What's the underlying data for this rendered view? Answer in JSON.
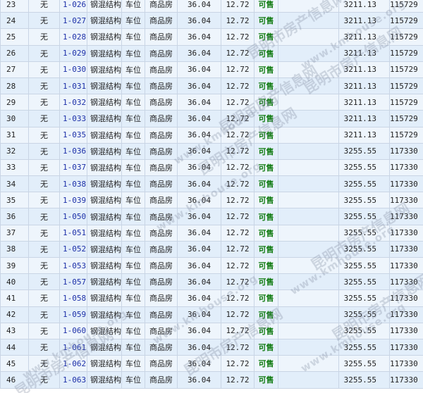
{
  "table": {
    "rows": [
      {
        "no": "23",
        "opt": "无",
        "unit": "1-026",
        "struct": "钢混结构",
        "use": "车位",
        "type": "商品房",
        "area1": "36.04",
        "area2": "12.72",
        "status": "可售",
        "price": "3211.13",
        "total": "115729"
      },
      {
        "no": "24",
        "opt": "无",
        "unit": "1-027",
        "struct": "钢混结构",
        "use": "车位",
        "type": "商品房",
        "area1": "36.04",
        "area2": "12.72",
        "status": "可售",
        "price": "3211.13",
        "total": "115729"
      },
      {
        "no": "25",
        "opt": "无",
        "unit": "1-028",
        "struct": "钢混结构",
        "use": "车位",
        "type": "商品房",
        "area1": "36.04",
        "area2": "12.72",
        "status": "可售",
        "price": "3211.13",
        "total": "115729"
      },
      {
        "no": "26",
        "opt": "无",
        "unit": "1-029",
        "struct": "钢混结构",
        "use": "车位",
        "type": "商品房",
        "area1": "36.04",
        "area2": "12.72",
        "status": "可售",
        "price": "3211.13",
        "total": "115729"
      },
      {
        "no": "27",
        "opt": "无",
        "unit": "1-030",
        "struct": "钢混结构",
        "use": "车位",
        "type": "商品房",
        "area1": "36.04",
        "area2": "12.72",
        "status": "可售",
        "price": "3211.13",
        "total": "115729"
      },
      {
        "no": "28",
        "opt": "无",
        "unit": "1-031",
        "struct": "钢混结构",
        "use": "车位",
        "type": "商品房",
        "area1": "36.04",
        "area2": "12.72",
        "status": "可售",
        "price": "3211.13",
        "total": "115729"
      },
      {
        "no": "29",
        "opt": "无",
        "unit": "1-032",
        "struct": "钢混结构",
        "use": "车位",
        "type": "商品房",
        "area1": "36.04",
        "area2": "12.72",
        "status": "可售",
        "price": "3211.13",
        "total": "115729"
      },
      {
        "no": "30",
        "opt": "无",
        "unit": "1-033",
        "struct": "钢混结构",
        "use": "车位",
        "type": "商品房",
        "area1": "36.04",
        "area2": "12.72",
        "status": "可售",
        "price": "3211.13",
        "total": "115729"
      },
      {
        "no": "31",
        "opt": "无",
        "unit": "1-035",
        "struct": "钢混结构",
        "use": "车位",
        "type": "商品房",
        "area1": "36.04",
        "area2": "12.72",
        "status": "可售",
        "price": "3211.13",
        "total": "115729"
      },
      {
        "no": "32",
        "opt": "无",
        "unit": "1-036",
        "struct": "钢混结构",
        "use": "车位",
        "type": "商品房",
        "area1": "36.04",
        "area2": "12.72",
        "status": "可售",
        "price": "3255.55",
        "total": "117330"
      },
      {
        "no": "33",
        "opt": "无",
        "unit": "1-037",
        "struct": "钢混结构",
        "use": "车位",
        "type": "商品房",
        "area1": "36.04",
        "area2": "12.72",
        "status": "可售",
        "price": "3255.55",
        "total": "117330"
      },
      {
        "no": "34",
        "opt": "无",
        "unit": "1-038",
        "struct": "钢混结构",
        "use": "车位",
        "type": "商品房",
        "area1": "36.04",
        "area2": "12.72",
        "status": "可售",
        "price": "3255.55",
        "total": "117330"
      },
      {
        "no": "35",
        "opt": "无",
        "unit": "1-039",
        "struct": "钢混结构",
        "use": "车位",
        "type": "商品房",
        "area1": "36.04",
        "area2": "12.72",
        "status": "可售",
        "price": "3255.55",
        "total": "117330"
      },
      {
        "no": "36",
        "opt": "无",
        "unit": "1-050",
        "struct": "钢混结构",
        "use": "车位",
        "type": "商品房",
        "area1": "36.04",
        "area2": "12.72",
        "status": "可售",
        "price": "3255.55",
        "total": "117330"
      },
      {
        "no": "37",
        "opt": "无",
        "unit": "1-051",
        "struct": "钢混结构",
        "use": "车位",
        "type": "商品房",
        "area1": "36.04",
        "area2": "12.72",
        "status": "可售",
        "price": "3255.55",
        "total": "117330"
      },
      {
        "no": "38",
        "opt": "无",
        "unit": "1-052",
        "struct": "钢混结构",
        "use": "车位",
        "type": "商品房",
        "area1": "36.04",
        "area2": "12.72",
        "status": "可售",
        "price": "3255.55",
        "total": "117330"
      },
      {
        "no": "39",
        "opt": "无",
        "unit": "1-053",
        "struct": "钢混结构",
        "use": "车位",
        "type": "商品房",
        "area1": "36.04",
        "area2": "12.72",
        "status": "可售",
        "price": "3255.55",
        "total": "117330"
      },
      {
        "no": "40",
        "opt": "无",
        "unit": "1-057",
        "struct": "钢混结构",
        "use": "车位",
        "type": "商品房",
        "area1": "36.04",
        "area2": "12.72",
        "status": "可售",
        "price": "3255.55",
        "total": "117330"
      },
      {
        "no": "41",
        "opt": "无",
        "unit": "1-058",
        "struct": "钢混结构",
        "use": "车位",
        "type": "商品房",
        "area1": "36.04",
        "area2": "12.72",
        "status": "可售",
        "price": "3255.55",
        "total": "117330"
      },
      {
        "no": "42",
        "opt": "无",
        "unit": "1-059",
        "struct": "钢混结构",
        "use": "车位",
        "type": "商品房",
        "area1": "36.04",
        "area2": "12.72",
        "status": "可售",
        "price": "3255.55",
        "total": "117330"
      },
      {
        "no": "43",
        "opt": "无",
        "unit": "1-060",
        "struct": "钢混结构",
        "use": "车位",
        "type": "商品房",
        "area1": "36.04",
        "area2": "12.72",
        "status": "可售",
        "price": "3255.55",
        "total": "117330"
      },
      {
        "no": "44",
        "opt": "无",
        "unit": "1-061",
        "struct": "钢混结构",
        "use": "车位",
        "type": "商品房",
        "area1": "36.04",
        "area2": "12.72",
        "status": "可售",
        "price": "3255.55",
        "total": "117330"
      },
      {
        "no": "45",
        "opt": "无",
        "unit": "1-062",
        "struct": "钢混结构",
        "use": "车位",
        "type": "商品房",
        "area1": "36.04",
        "area2": "12.72",
        "status": "可售",
        "price": "3255.55",
        "total": "117330"
      },
      {
        "no": "46",
        "opt": "无",
        "unit": "1-063",
        "struct": "钢混结构",
        "use": "车位",
        "type": "商品房",
        "area1": "36.04",
        "area2": "12.72",
        "status": "可售",
        "price": "3255.55",
        "total": "117330"
      }
    ]
  },
  "watermark": {
    "text": "昆明市房产信息网",
    "url": "www.kmhouse.org"
  },
  "colors": {
    "row_odd": "#eef5fc",
    "row_even": "#e2eefa",
    "border": "#c9d5e5",
    "unit_link": "#1c2fa8",
    "status_available": "#0f7a0f"
  }
}
